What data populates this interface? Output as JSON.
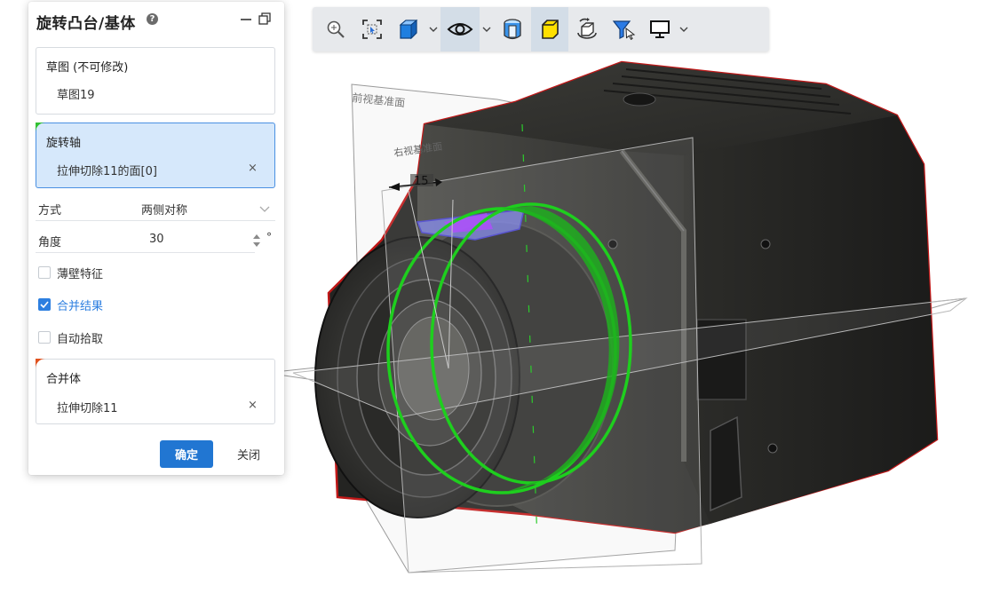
{
  "panel": {
    "title": "旋转凸台/基体",
    "help_icon": "help-circle-icon",
    "minimize_icon": "minimize-icon",
    "restore_icon": "restore-window-icon",
    "sketch_box": {
      "label": "草图 (不可修改)",
      "value": "草图19",
      "marker_color": "#b11fe0"
    },
    "axis_box": {
      "label": "旋转轴",
      "value": "拉伸切除11的面[0]",
      "remove": "×",
      "marker_color": "#33c133"
    },
    "method": {
      "label": "方式",
      "value": "两侧对称"
    },
    "angle": {
      "label": "角度",
      "value": "30",
      "unit": "°"
    },
    "thin_feature": {
      "label": "薄壁特征",
      "checked": false
    },
    "merge_result": {
      "label": "合并结果",
      "checked": true
    },
    "auto_pick": {
      "label": "自动拾取",
      "checked": false
    },
    "merge_body_box": {
      "label": "合并体",
      "value": "拉伸切除11",
      "remove": "×",
      "marker_color": "#e0521f"
    },
    "ok_label": "确定",
    "close_label": "关闭"
  },
  "toolbar": {
    "items": [
      {
        "icon": "zoom-icon"
      },
      {
        "icon": "zoom-to-fit-icon"
      },
      {
        "icon": "view-cube-icon",
        "dropdown": true
      },
      {
        "icon": "visibility-eye-icon",
        "dropdown": true,
        "active": true
      },
      {
        "icon": "section-view-icon"
      },
      {
        "icon": "shaded-display-icon",
        "active": true
      },
      {
        "icon": "rotate-view-icon"
      },
      {
        "icon": "selection-filter-icon"
      },
      {
        "icon": "display-settings-icon",
        "dropdown": true
      }
    ]
  },
  "viewport": {
    "front_plane_label": "前视基准面",
    "right_plane_label": "右视基准面",
    "dimension_value": "15",
    "accent_green": "#22cc22",
    "model_edge_red": "#c01818"
  }
}
